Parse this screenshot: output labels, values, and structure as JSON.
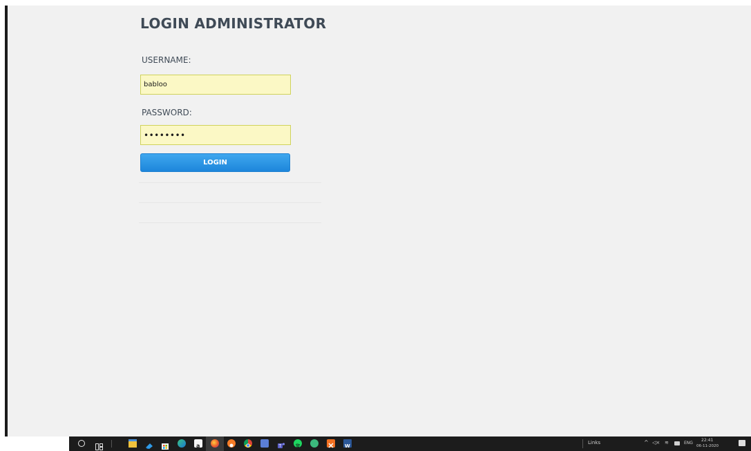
{
  "login": {
    "title": "LOGIN ADMINISTRATOR",
    "username_label": "USERNAME:",
    "username_value": "babloo",
    "password_label": "PASSWORD:",
    "password_value": "password",
    "login_button": "LOGIN"
  },
  "taskbar": {
    "links_label": "Links",
    "language": "ENG",
    "time": "22:41",
    "date": "06-11-2020",
    "pinned_apps": [
      "file-explorer-icon",
      "media-player-icon",
      "store-icon",
      "edge-icon",
      "amazon-icon",
      "firefox-icon",
      "brave-icon",
      "chrome-icon",
      "chat-icon",
      "teams-icon",
      "spotify-icon",
      "browser-icon",
      "xampp-icon",
      "word-icon"
    ]
  },
  "colors": {
    "input_background": "#fbf8c5",
    "input_border": "#cfd25a",
    "button_blue": "#1d86db",
    "page_background": "#f1f1f1",
    "taskbar_background": "#1c1c1c"
  }
}
